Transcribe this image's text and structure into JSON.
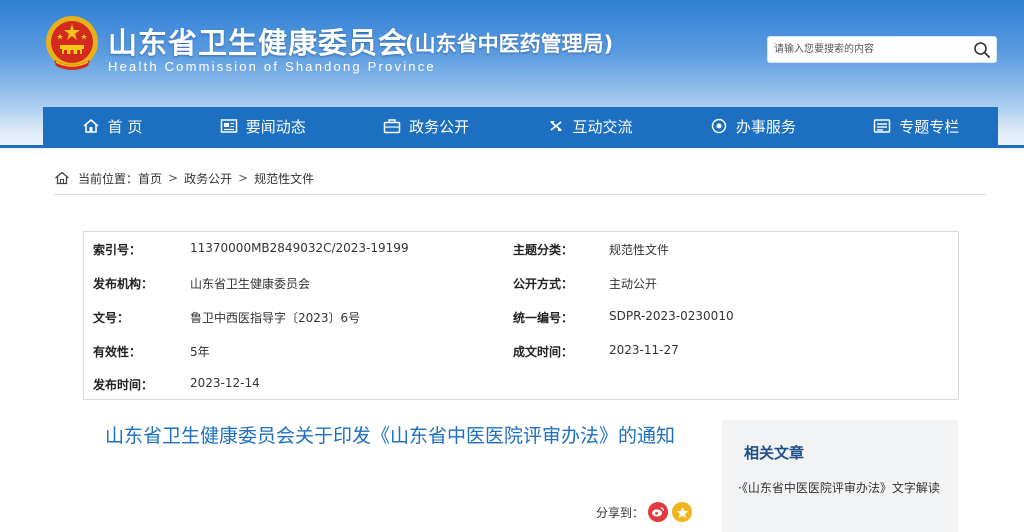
{
  "header": {
    "title": "山东省卫生健康委员会",
    "subtitle": "(山东省中医药管理局)",
    "title_en": "Health Commission of Shandong Province",
    "search_placeholder": "请输入您要搜索的内容",
    "colors": {
      "brand": "#1d6fc2",
      "header_top": "#2f7fd4"
    }
  },
  "nav": {
    "items": [
      {
        "label": "首 页",
        "icon": "home-icon"
      },
      {
        "label": "要闻动态",
        "icon": "news-icon"
      },
      {
        "label": "政务公开",
        "icon": "briefcase-icon"
      },
      {
        "label": "互动交流",
        "icon": "exchange-icon"
      },
      {
        "label": "办事服务",
        "icon": "service-icon"
      },
      {
        "label": "专题专栏",
        "icon": "column-icon"
      }
    ]
  },
  "breadcrumb": {
    "prefix": "当前位置：",
    "items": [
      "首页",
      "政务公开",
      "规范性文件"
    ],
    "separator": ">"
  },
  "meta": {
    "index_label": "索引号：",
    "index_value": "11370000MB2849032C/2023-19199",
    "category_label": "主题分类：",
    "category_value": "规范性文件",
    "publisher_label": "发布机构：",
    "publisher_value": "山东省卫生健康委员会",
    "open_label": "公开方式：",
    "open_value": "主动公开",
    "doc_label": "文号：",
    "doc_value": "鲁卫中西医指导字〔2023〕6号",
    "code_label": "统一编号：",
    "code_value": "SDPR-2023-0230010",
    "validity_label": "有效性：",
    "validity_value": "5年",
    "created_label": "成文时间：",
    "created_value": "2023-11-27",
    "published_label": "发布时间：",
    "published_value": "2023-12-14"
  },
  "article": {
    "title": "山东省卫生健康委员会关于印发《山东省中医医院评审办法》的通知",
    "share_label": "分享到："
  },
  "related": {
    "title": "相关文章",
    "items": [
      "·《山东省中医医院评审办法》文字解读"
    ]
  }
}
